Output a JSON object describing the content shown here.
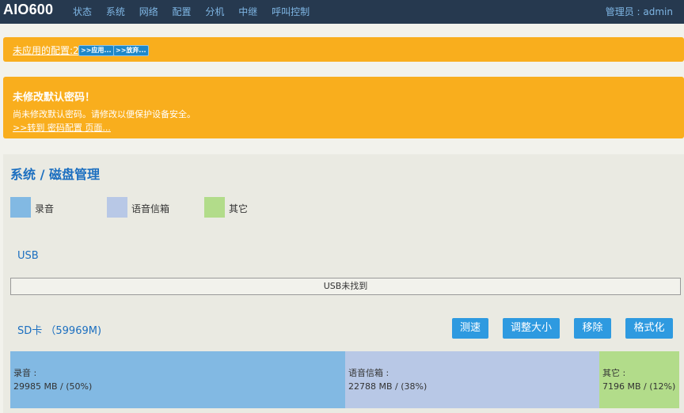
{
  "brand": "AIO600",
  "nav": [
    "状态",
    "系统",
    "网络",
    "配置",
    "分机",
    "中继",
    "呼叫控制"
  ],
  "admin": "管理员 : admin",
  "banner_unapplied": {
    "text": "未应用的配置:2",
    "apply": ">>应用...",
    "discard": ">>放弃..."
  },
  "banner_password": {
    "title": "未修改默认密码！",
    "line": "尚未修改默认密码。请修改以便保护设备安全。",
    "link": ">>转到 密码配置 页面..."
  },
  "panel": {
    "title": "系统 / 磁盘管理",
    "legend": [
      {
        "label": "录音",
        "color": "#82b9e3"
      },
      {
        "label": "语音信箱",
        "color": "#b8c8e6"
      },
      {
        "label": "其它",
        "color": "#b2dc8a"
      }
    ],
    "usb": {
      "title": "USB",
      "status": "USB未找到"
    },
    "sd": {
      "title": "SD卡 （59969M)",
      "buttons": [
        "测速",
        "调整大小",
        "移除",
        "格式化"
      ],
      "segments": [
        {
          "name": "录音 :",
          "value": "29985 MB / (50%)",
          "share": 50,
          "color": "#82b9e3"
        },
        {
          "name": "语音信箱 :",
          "value": "22788 MB / (38%)",
          "share": 38,
          "color": "#b8c8e6"
        },
        {
          "name": "其它 :",
          "value": "7196 MB / (12%)",
          "share": 12,
          "color": "#b2dc8a"
        }
      ]
    }
  }
}
